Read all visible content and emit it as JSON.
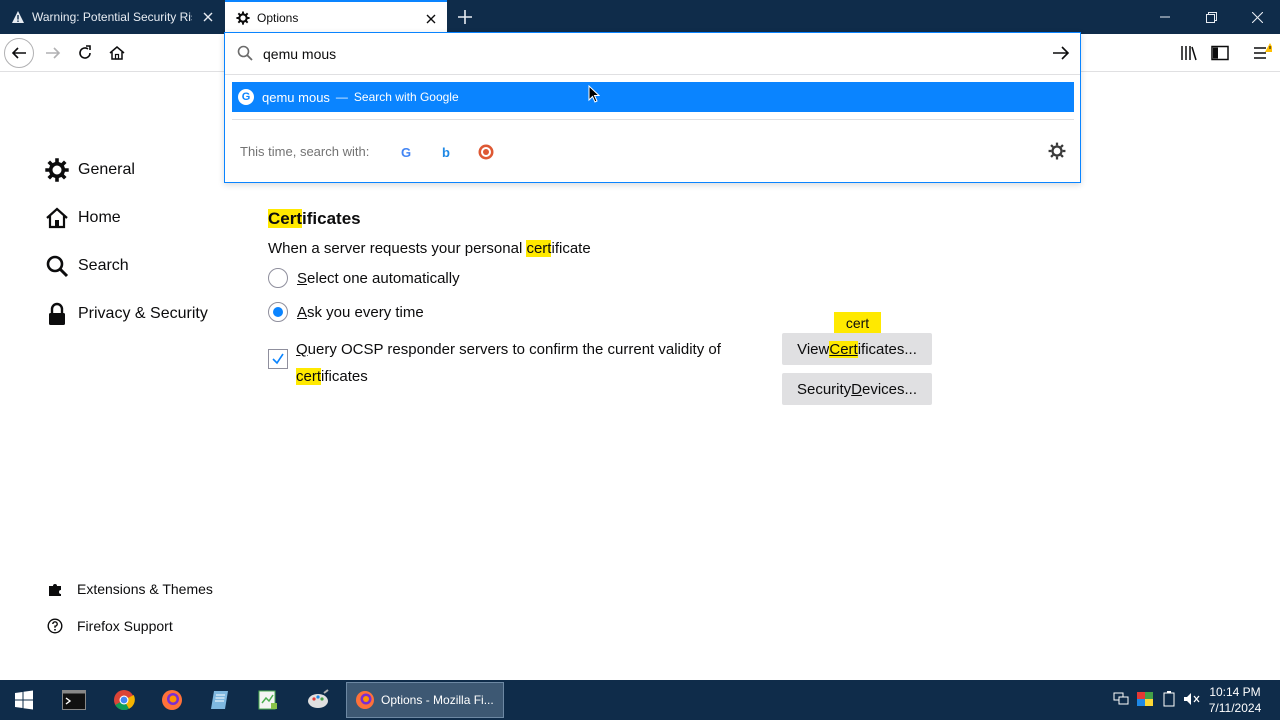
{
  "tabs": [
    {
      "title": "Warning: Potential Security Risk",
      "icon": "warning-icon"
    },
    {
      "title": "Options",
      "icon": "gear-icon"
    }
  ],
  "urlbar": {
    "value": "qemu mous",
    "suggestion": {
      "text": "qemu mous",
      "separator": "—",
      "action": "Search with Google"
    },
    "oneoff_label": "This time, search with:",
    "engines": [
      "Google",
      "Bing",
      "DuckDuckGo"
    ]
  },
  "sidebar": {
    "categories": [
      {
        "label": "General",
        "icon": "gear-icon"
      },
      {
        "label": "Home",
        "icon": "home-icon"
      },
      {
        "label": "Search",
        "icon": "search-icon"
      },
      {
        "label": "Privacy & Security",
        "icon": "lock-icon"
      }
    ],
    "footer": [
      {
        "label": "Extensions & Themes",
        "icon": "puzzle-icon"
      },
      {
        "label": "Firefox Support",
        "icon": "help-icon"
      }
    ]
  },
  "certificates": {
    "title_hl": "Cert",
    "title_rest": "ificates",
    "prompt_pre": "When a server requests your personal ",
    "prompt_hl": "cert",
    "prompt_rest": "ificate",
    "option_auto_u": "S",
    "option_auto_rest": "elect one automatically",
    "option_ask_u": "A",
    "option_ask_rest": "sk you every time",
    "ocsp_u": "Q",
    "ocsp_rest": "uery OCSP responder servers to confirm the current validity of",
    "ocsp_hl": "cert",
    "ocsp_end": "ificates",
    "view_pre": "View ",
    "view_hl": "Cert",
    "view_rest": "ificates...",
    "devices_pre": "Security ",
    "devices_u": "D",
    "devices_rest": "evices...",
    "tooltip": "cert"
  },
  "taskbar": {
    "active_label": "Options - Mozilla Fi...",
    "time": "10:14 PM",
    "date": "7/11/2024"
  },
  "colors": {
    "accent": "#0a84ff",
    "highlight": "#ffe900",
    "titlebar": "#0f2c4a"
  }
}
